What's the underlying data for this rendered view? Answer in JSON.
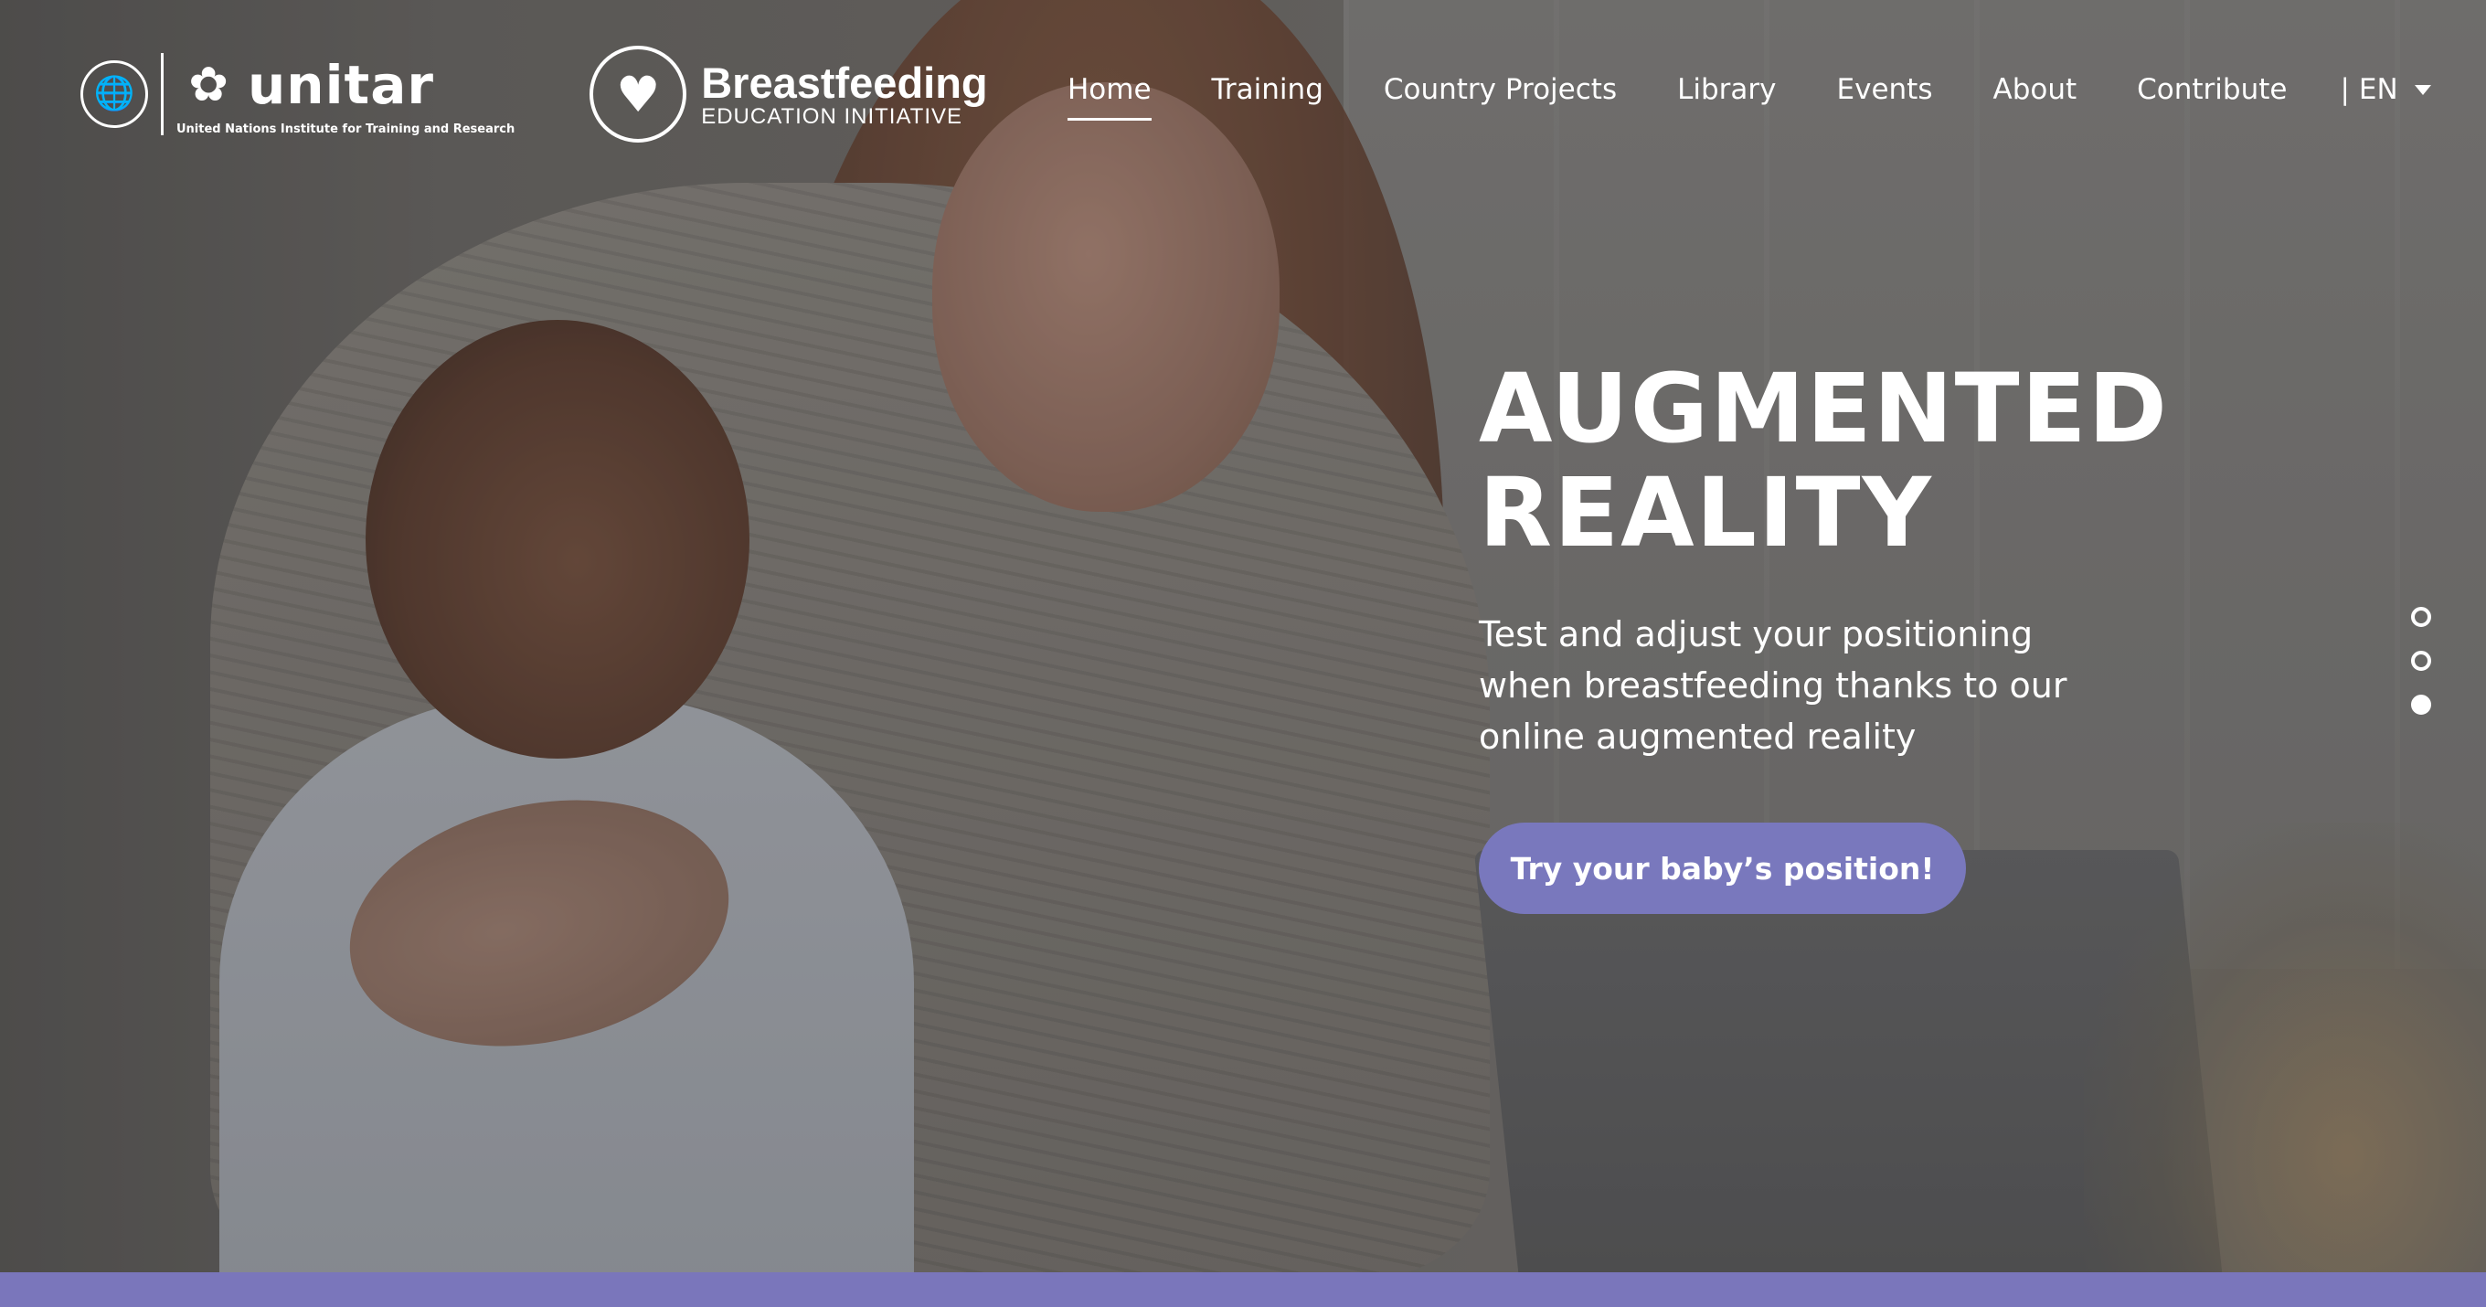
{
  "brand": {
    "un_emblem_icon": "un-emblem",
    "unitar_mark_icon": "unitar-thistle",
    "unitar_name": "unitar",
    "unitar_subtitle": "United Nations Institute for Training and Research",
    "bf_logo_icon": "mother-child",
    "bf_title": "Breastfeeding",
    "bf_subtitle": "EDUCATION INITIATIVE"
  },
  "nav": {
    "items": [
      {
        "label": "Home",
        "active": true
      },
      {
        "label": "Training"
      },
      {
        "label": "Country Projects"
      },
      {
        "label": "Library"
      },
      {
        "label": "Events"
      },
      {
        "label": "About"
      },
      {
        "label": "Contribute"
      }
    ],
    "lang_separator": "|",
    "lang": "EN"
  },
  "hero": {
    "title": "AUGMENTED\nREALITY",
    "text": "Test and adjust your positioning when breastfeeding thanks to our online augmented reality",
    "cta_label": "Try your baby’s position!",
    "slides": 3,
    "active_slide": 3
  },
  "colors": {
    "accent": "#7978bd",
    "band": "#7a76bb"
  }
}
